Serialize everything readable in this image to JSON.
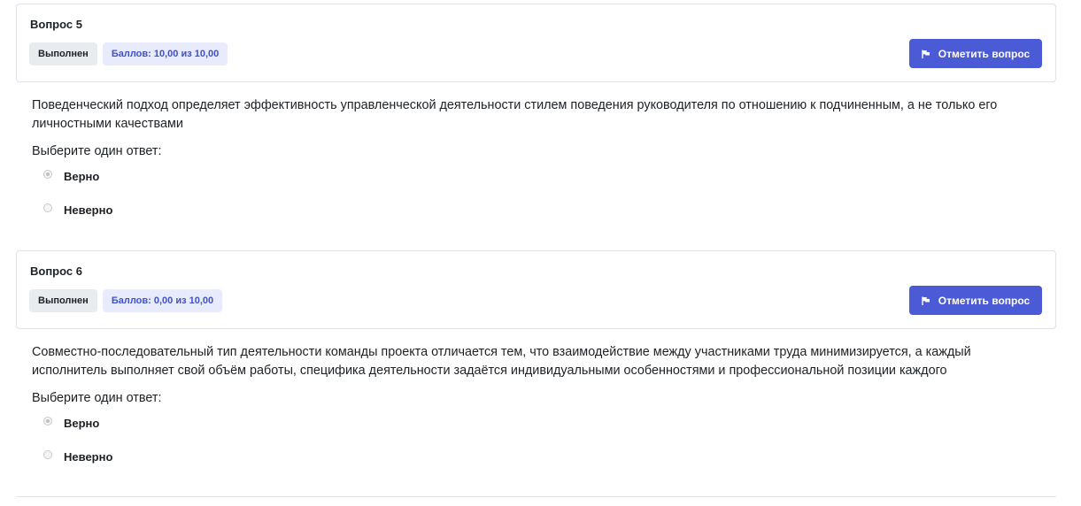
{
  "questions": [
    {
      "number_label": "Вопрос 5",
      "state": "Выполнен",
      "grade": "Баллов: 10,00 из 10,00",
      "flag_label": "Отметить вопрос",
      "text": "Поведенческий подход определяет эффективность управленческой деятельности стилем поведения руководителя по отношению к подчиненным, а не только его личностными качествами",
      "prompt": "Выберите один ответ:",
      "answers": [
        {
          "label": "Верно",
          "checked": true
        },
        {
          "label": "Неверно",
          "checked": false
        }
      ]
    },
    {
      "number_label": "Вопрос 6",
      "state": "Выполнен",
      "grade": "Баллов: 0,00 из 10,00",
      "flag_label": "Отметить вопрос",
      "text": "Совместно-последовательный тип деятельности команды проекта отличается тем, что взаимодействие между участниками труда минимизируется, а каждый исполнитель выполняет свой объём работы, специфика деятельности задаётся индивидуальными особенностями и профессиональной позиции каждого",
      "prompt": "Выберите один ответ:",
      "answers": [
        {
          "label": "Верно",
          "checked": true
        },
        {
          "label": "Неверно",
          "checked": false
        }
      ]
    }
  ],
  "colors": {
    "accent": "#4b5bd6",
    "grade_badge_bg": "#e8ebfb",
    "grade_badge_text": "#3f51c8",
    "state_badge_bg": "#e9ecef",
    "border": "#dee2e6"
  },
  "icons": {
    "flag": "flag-icon"
  }
}
